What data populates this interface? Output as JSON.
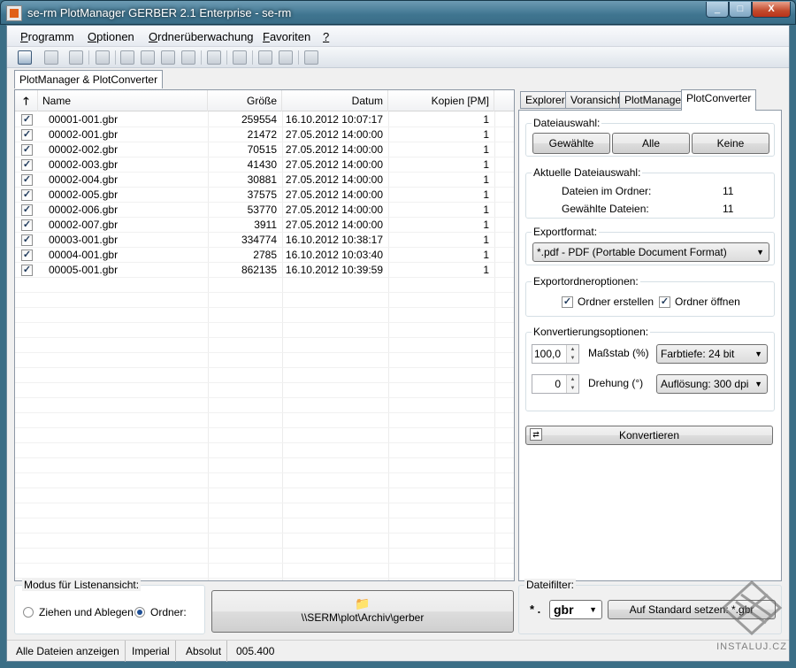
{
  "window": {
    "title": "se-rm PlotManager GERBER 2.1 Enterprise - se-rm",
    "btn_min": "_",
    "btn_max": "□",
    "btn_close": "X"
  },
  "menu": {
    "items": [
      {
        "u": "P",
        "rest": "rogramm"
      },
      {
        "u": "O",
        "rest": "ptionen"
      },
      {
        "u": "O",
        "rest": "rdnerüberwachung"
      },
      {
        "u": "F",
        "rest": "avoriten"
      },
      {
        "u": "?",
        "rest": ""
      }
    ]
  },
  "doc_tab": "PlotManager & PlotConverter",
  "list": {
    "sort_icon": "arrow-up",
    "columns": [
      "Name",
      "Größe",
      "Datum",
      "Kopien [PM]"
    ],
    "rows": [
      {
        "name": "00001-001.gbr",
        "size": "259554",
        "date": "16.10.2012 10:07:17",
        "copies": "1",
        "checked": true
      },
      {
        "name": "00002-001.gbr",
        "size": "21472",
        "date": "27.05.2012 14:00:00",
        "copies": "1",
        "checked": true
      },
      {
        "name": "00002-002.gbr",
        "size": "70515",
        "date": "27.05.2012 14:00:00",
        "copies": "1",
        "checked": true
      },
      {
        "name": "00002-003.gbr",
        "size": "41430",
        "date": "27.05.2012 14:00:00",
        "copies": "1",
        "checked": true
      },
      {
        "name": "00002-004.gbr",
        "size": "30881",
        "date": "27.05.2012 14:00:00",
        "copies": "1",
        "checked": true
      },
      {
        "name": "00002-005.gbr",
        "size": "37575",
        "date": "27.05.2012 14:00:00",
        "copies": "1",
        "checked": true
      },
      {
        "name": "00002-006.gbr",
        "size": "53770",
        "date": "27.05.2012 14:00:00",
        "copies": "1",
        "checked": true
      },
      {
        "name": "00002-007.gbr",
        "size": "3911",
        "date": "27.05.2012 14:00:00",
        "copies": "1",
        "checked": true
      },
      {
        "name": "00003-001.gbr",
        "size": "334774",
        "date": "16.10.2012 10:38:17",
        "copies": "1",
        "checked": true
      },
      {
        "name": "00004-001.gbr",
        "size": "2785",
        "date": "16.10.2012 10:03:40",
        "copies": "1",
        "checked": true
      },
      {
        "name": "00005-001.gbr",
        "size": "862135",
        "date": "16.10.2012 10:39:59",
        "copies": "1",
        "checked": true
      }
    ]
  },
  "tabs": [
    "Explorer",
    "Voransicht",
    "PlotManager",
    "PlotConverter"
  ],
  "active_tab": "PlotConverter",
  "converter": {
    "dateiauswahl": {
      "title": "Dateiauswahl:",
      "btn_selected": "Gewählte",
      "btn_all": "Alle",
      "btn_none": "Keine"
    },
    "aktuelle": {
      "title": "Aktuelle Dateiauswahl:",
      "in_folder_label": "Dateien im Ordner:",
      "in_folder_value": "11",
      "selected_label": "Gewählte Dateien:",
      "selected_value": "11"
    },
    "exportformat": {
      "title": "Exportformat:",
      "value": "*.pdf - PDF (Portable Document Format)"
    },
    "exportordner": {
      "title": "Exportordneroptionen:",
      "create_label": "Ordner erstellen",
      "open_label": "Ordner öffnen"
    },
    "konvert": {
      "title": "Konvertierungsoptionen:",
      "scale_value": "100,0",
      "scale_label": "Maßstab (%)",
      "depth": "Farbtiefe: 24 bit",
      "rotation_value": "0",
      "rotation_label": "Drehung (°)",
      "resolution": "Auflösung: 300 dpi"
    },
    "convert_btn": "Konvertieren"
  },
  "bottom": {
    "mode_title": "Modus für Listenansicht:",
    "radio_drag": "Ziehen und Ablegen",
    "radio_folder": "Ordner:",
    "folder_path": "\\\\SERM\\plot\\Archiv\\gerber",
    "filter_title": "Dateifilter:",
    "filter_prefix": "* .",
    "filter_value": "gbr",
    "filter_reset": "Auf Standard setzen: *.gbr"
  },
  "status": [
    "Alle Dateien anzeigen",
    "Imperial",
    "Absolut",
    "005.400"
  ],
  "watermark": "INSTALUJ.CZ"
}
